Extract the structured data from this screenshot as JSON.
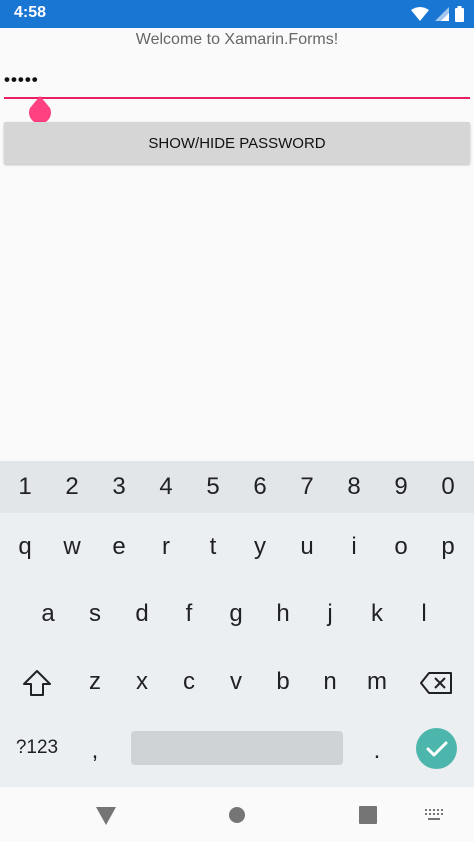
{
  "status_bar": {
    "time": "4:58",
    "icons": [
      "wifi-icon",
      "cell-signal-icon",
      "battery-icon"
    ]
  },
  "app": {
    "welcome_text": "Welcome to Xamarin.Forms!",
    "password_value": "•••••",
    "toggle_button_label": "SHOW/HIDE PASSWORD",
    "accent_color": "#e91e63"
  },
  "keyboard": {
    "number_row": [
      "1",
      "2",
      "3",
      "4",
      "5",
      "6",
      "7",
      "8",
      "9",
      "0"
    ],
    "row1": [
      "q",
      "w",
      "e",
      "r",
      "t",
      "y",
      "u",
      "i",
      "o",
      "p"
    ],
    "row2": [
      "a",
      "s",
      "d",
      "f",
      "g",
      "h",
      "j",
      "k",
      "l"
    ],
    "row3": [
      "z",
      "x",
      "c",
      "v",
      "b",
      "n",
      "m"
    ],
    "symbols_label": "?123",
    "comma": ",",
    "period": ".",
    "enter_color": "#4db6ac"
  },
  "nav_bar": {
    "icons": [
      "back-icon",
      "home-icon",
      "recents-icon",
      "keyboard-switch-icon"
    ]
  }
}
